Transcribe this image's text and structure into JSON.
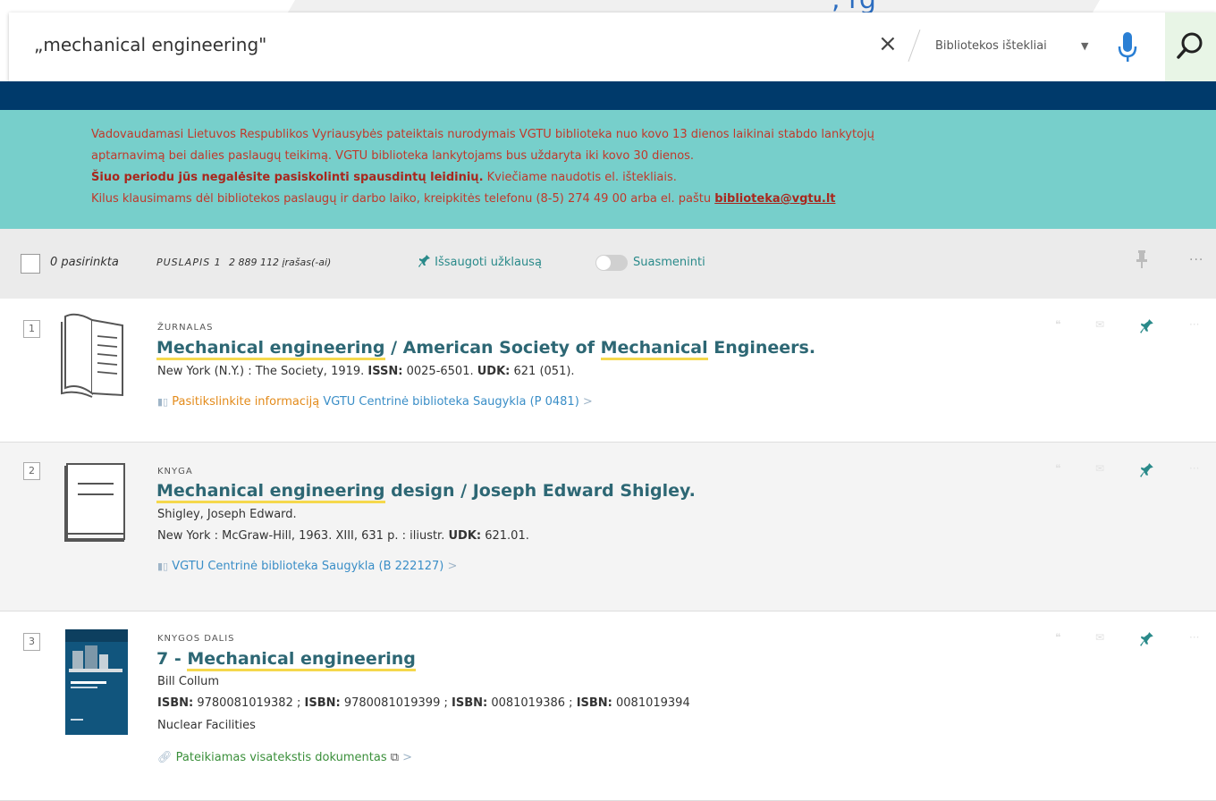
{
  "search": {
    "query": "„mechanical engineering\"",
    "clear_label": "×",
    "scope": "Bibliotekos ištekliai",
    "top_partial_text": ", rg"
  },
  "alert": {
    "line1": "Vadovaudamasi Lietuvos Respublikos Vyriausybės pateiktais nurodymais VGTU biblioteka nuo kovo 13 dienos laikinai stabdo lankytojų",
    "line2": "aptarnavimą bei dalies paslaugų teikimą. VGTU biblioteka lankytojams bus uždaryta iki kovo 30 dienos.",
    "line3_bold": "Šiuo periodu jūs negalėsite pasiskolinti spausdintų leidinių.",
    "line3_rest": " Kviečiame naudotis el. ištekliais.",
    "line4": "Kilus klausimams dėl bibliotekos paslaugų ir darbo laiko, kreipkitės telefonu (8-5) 274 49 00 arba el. paštu ",
    "email": "biblioteka@vgtu.lt"
  },
  "toolbar": {
    "selected": "0 pasirinkta",
    "page_label": "PUSLAPIS 1",
    "count": "2 889 112 įrašas(-ai)",
    "save_query": "Išsaugoti užklausą",
    "personalize": "Suasmeninti",
    "more": "···"
  },
  "results": [
    {
      "index": "1",
      "type": "ŽURNALAS",
      "title_hl1": "Mechanical engineering",
      "title_mid": " / American Society of ",
      "title_hl2": "Mechanical",
      "title_end": " Engineers.",
      "pub_pre": "New York (N.Y.) : The Society, 1919. ",
      "issn_label": "ISSN:",
      "issn": " 0025-6501. ",
      "udk_label": "UDK:",
      "udk": " 621 (051).",
      "avail_status": "Pasitikslinkite informaciją",
      "avail_library": "VGTU Centrinė biblioteka",
      "avail_location": "Saugykla (P 0481)",
      "avail_arrow": ">"
    },
    {
      "index": "2",
      "type": "KNYGA",
      "title_hl1": "Mechanical engineering",
      "title_end": " design / Joseph Edward Shigley.",
      "author": "Shigley, Joseph Edward.",
      "pub_pre": "New York : McGraw-Hill, 1963. XIII, 631 p. : iliustr. ",
      "udk_label": "UDK:",
      "udk": " 621.01.",
      "avail_library": "VGTU Centrinė biblioteka",
      "avail_location": "Saugykla (B 222127)",
      "avail_arrow": ">"
    },
    {
      "index": "3",
      "type": "KNYGOS DALIS",
      "title_pre": "7 - ",
      "title_hl1": "Mechanical engineering",
      "author": "Bill Collum",
      "isbn_label": "ISBN:",
      "isbn1": " 9780081019382 ; ",
      "isbn2": " 9780081019399 ; ",
      "isbn3": " 0081019386 ; ",
      "isbn4": " 0081019394",
      "source": "Nuclear Facilities",
      "fulltext": "Pateikiamas visatekstis dokumentas",
      "fulltext_arrow": ">"
    }
  ],
  "colors": {
    "navy": "#003a6b",
    "alert_bg": "#77cfcb",
    "alert_text": "#c0392b",
    "title": "#2d6774",
    "pin": "#2a8a8a",
    "highlight": "#f5d84c"
  }
}
